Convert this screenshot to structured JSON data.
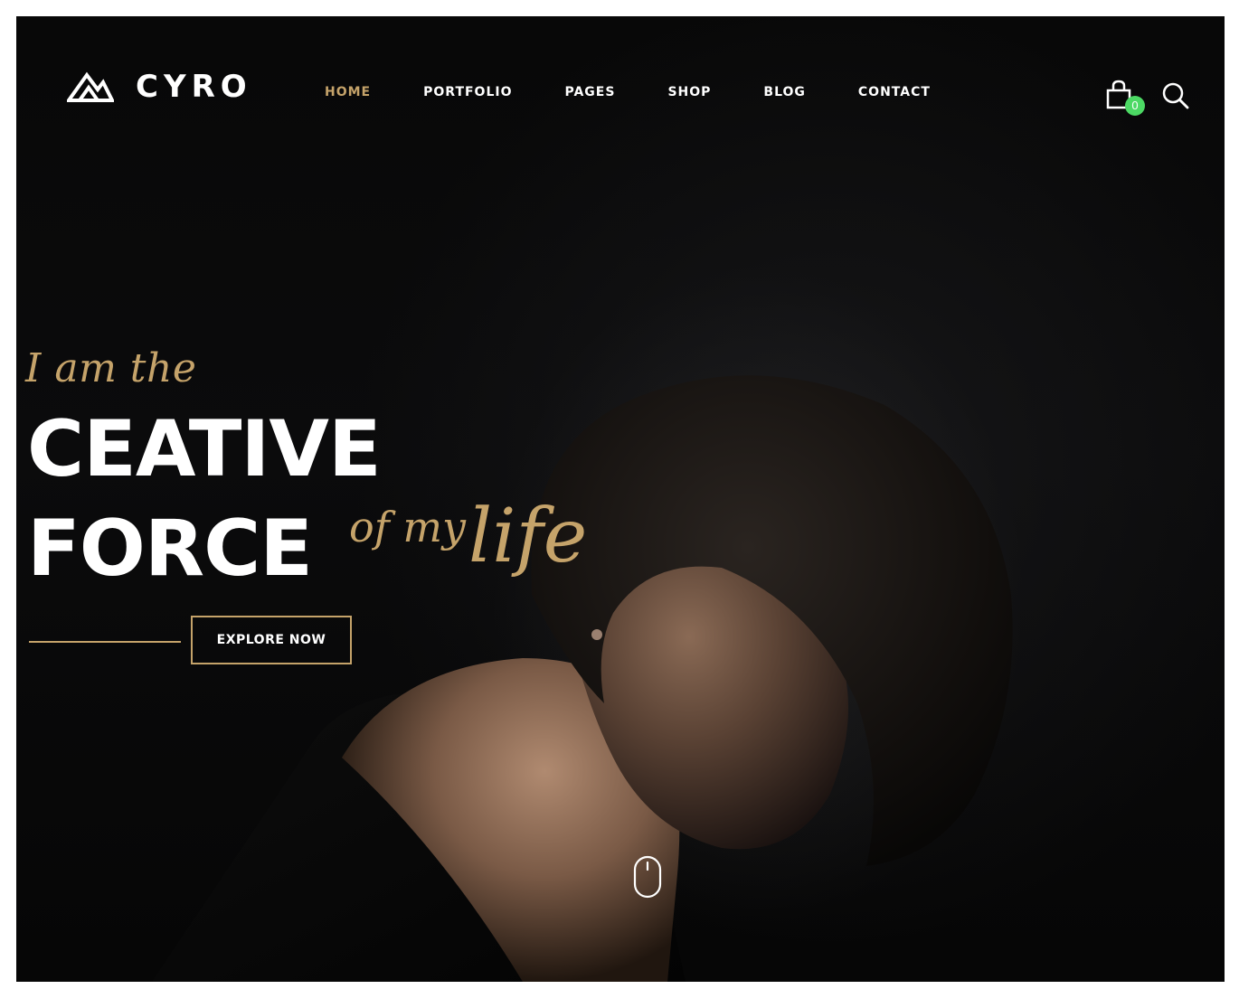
{
  "brand": {
    "name": "CYRO",
    "logo_icon": "mountain-icon"
  },
  "nav": {
    "items": [
      {
        "label": "HOME",
        "active": true
      },
      {
        "label": "PORTFOLIO",
        "active": false
      },
      {
        "label": "PAGES",
        "active": false
      },
      {
        "label": "SHOP",
        "active": false
      },
      {
        "label": "BLOG",
        "active": false
      },
      {
        "label": "CONTACT",
        "active": false
      }
    ]
  },
  "header_actions": {
    "cart_icon": "shopping-bag-icon",
    "cart_count": "0",
    "search_icon": "search-icon"
  },
  "hero": {
    "intro": "I am the",
    "line1": "CEATIVE",
    "line2": "FORCE",
    "accent_small": "of my",
    "accent_large": "life",
    "cta_label": "EXPLORE NOW",
    "scroll_icon": "mouse-scroll-icon"
  },
  "colors": {
    "background": "#070707",
    "accent": "#c5a36a",
    "text": "#ffffff",
    "badge": "#4cd964"
  }
}
